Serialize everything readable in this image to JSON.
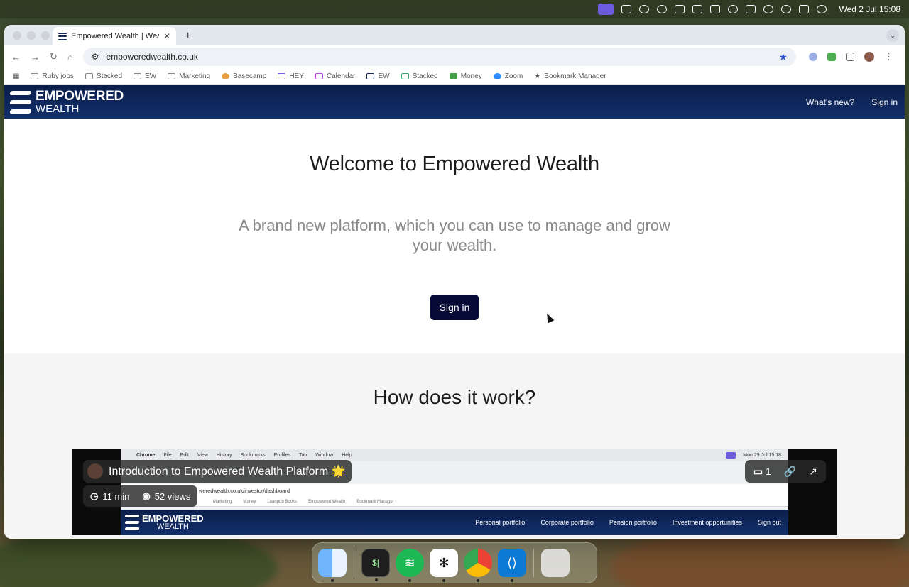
{
  "menubar": {
    "datetime": "Wed 2 Jul  15:08"
  },
  "browser": {
    "tab_title": "Empowered Wealth | Wealth M",
    "new_tab": "+",
    "url": "empoweredwealth.co.uk",
    "bookmarks": [
      "Ruby jobs",
      "Stacked",
      "EW",
      "Marketing",
      "Basecamp",
      "HEY",
      "Calendar",
      "EW",
      "Stacked",
      "Money",
      "Zoom",
      "Bookmark Manager"
    ]
  },
  "site": {
    "logo_line1": "EMPOWERED",
    "logo_line2": "WEALTH",
    "nav": {
      "whats_new": "What's new?",
      "sign_in": "Sign in"
    },
    "hero": {
      "title": "Welcome to Empowered Wealth",
      "subtitle": "A brand new platform, which you can use to manage and grow your wealth.",
      "cta": "Sign in"
    },
    "how": {
      "title": "How does it work?"
    }
  },
  "video": {
    "title": "Introduction to Empowered Wealth Platform 🌟",
    "duration": "11 min",
    "views": "52 views",
    "comments": "1",
    "inner": {
      "menu": [
        "Chrome",
        "File",
        "Edit",
        "View",
        "History",
        "Bookmarks",
        "Profiles",
        "Tab",
        "Window",
        "Help"
      ],
      "date": "Mon 29 Jul  15:18",
      "url": "weredwealth.co.uk/investor/dashboard",
      "bookmarks": [
        "Marketing",
        "Money",
        "Leanpub Books",
        "Empowered Wealth",
        "Bookmark Manager"
      ],
      "logo_line1": "EMPOWERED",
      "logo_line2": "WEALTH",
      "nav": [
        "Personal portfolio",
        "Corporate portfolio",
        "Pension portfolio",
        "Investment opportunities",
        "Sign out"
      ]
    }
  },
  "colors": {
    "brand_navy": "#0b1e4a",
    "cta_bg": "#070a35",
    "accent_blue": "#2b55c9"
  }
}
